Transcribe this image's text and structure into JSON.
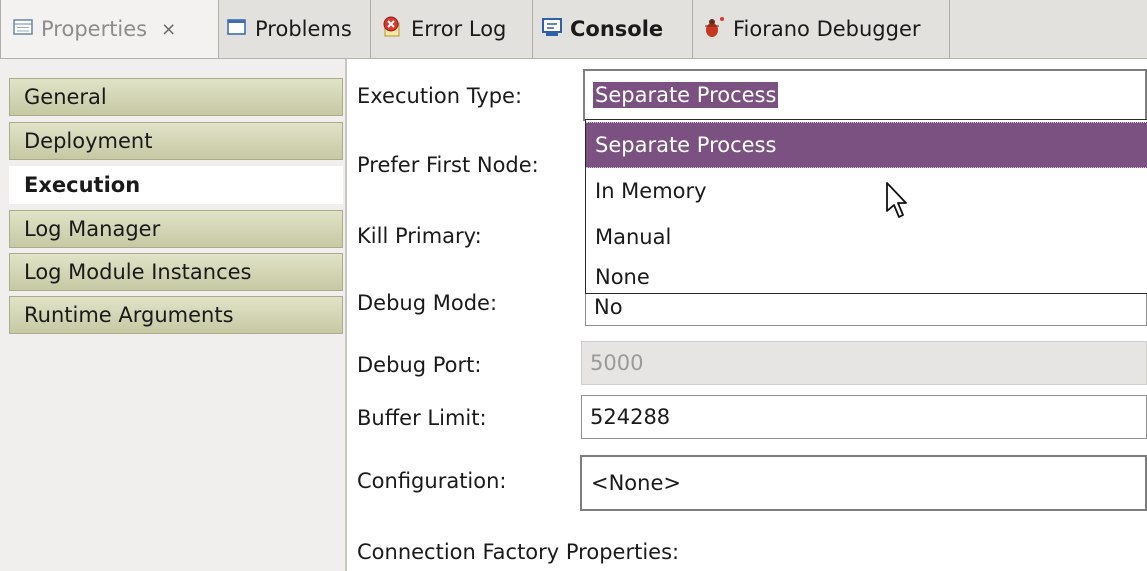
{
  "tabs": [
    {
      "label": "Properties",
      "icon": "properties-icon",
      "active": true,
      "close_glyph": "⨯"
    },
    {
      "label": "Problems",
      "icon": "problems-icon"
    },
    {
      "label": "Error Log",
      "icon": "error-log-icon"
    },
    {
      "label": "Console",
      "icon": "console-icon"
    },
    {
      "label": "Fiorano Debugger",
      "icon": "debugger-icon"
    }
  ],
  "nav": {
    "items": [
      {
        "label": "General"
      },
      {
        "label": "Deployment"
      },
      {
        "label": "Execution",
        "selected": true
      },
      {
        "label": "Log Manager"
      },
      {
        "label": "Log Module Instances"
      },
      {
        "label": "Runtime Arguments"
      }
    ]
  },
  "form": {
    "execution_type": {
      "label": "Execution Type:",
      "value": "Separate Process"
    },
    "prefer_first_node": {
      "label": "Prefer First Node:"
    },
    "kill_primary": {
      "label": "Kill Primary:"
    },
    "debug_mode": {
      "label": "Debug Mode:",
      "value": "No"
    },
    "debug_port": {
      "label": "Debug Port:",
      "value": "5000"
    },
    "buffer_limit": {
      "label": "Buffer Limit:",
      "value": "524288"
    },
    "configuration": {
      "label": "Configuration:",
      "value": "<None>"
    },
    "connection_factory": {
      "label": "Connection Factory Properties:"
    }
  },
  "dropdown": {
    "options": [
      "Separate Process",
      "In Memory",
      "Manual",
      "None"
    ],
    "selected": "Separate Process"
  },
  "colors": {
    "selection": "#7a5180",
    "nav_item": "#c6c9a3",
    "tabbar": "#e3e1de"
  }
}
